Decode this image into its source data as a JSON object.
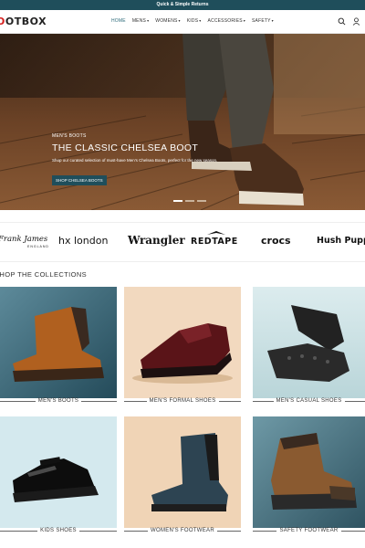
{
  "announcement": "Quick & Simple Returns",
  "logo": {
    "part_red": "FO",
    "part_black": "OTBOX"
  },
  "nav": [
    {
      "label": "HOME",
      "caret": false
    },
    {
      "label": "MENS",
      "caret": true
    },
    {
      "label": "WOMENS",
      "caret": true
    },
    {
      "label": "KIDS",
      "caret": true
    },
    {
      "label": "ACCESSORIES",
      "caret": true
    },
    {
      "label": "SAFETY",
      "caret": true
    }
  ],
  "icons": [
    "search-icon",
    "account-icon"
  ],
  "hero": {
    "eyebrow": "MEN'S BOOTS",
    "title": "THE CLASSIC CHELSEA BOOT",
    "description": "Shop our curated selection of must-have Men's Chelsea Boots, perfect for the new season.",
    "button": "SHOP CHELSEA BOOTS",
    "slide_count": 3,
    "active_slide": 1
  },
  "brands": [
    "Frank James",
    "ENGLAND",
    "hx london",
    "Wrangler",
    "REDTAPE",
    "crocs",
    "Hush Puppies"
  ],
  "collections_title": "SHOP THE COLLECTIONS",
  "collections": [
    {
      "label": "MEN'S BOOTS"
    },
    {
      "label": "MEN'S FORMAL SHOES"
    },
    {
      "label": "MEN'S CASUAL SHOES"
    },
    {
      "label": "KIDS SHOES"
    },
    {
      "label": "WOMEN'S FOOTWEAR"
    },
    {
      "label": "SAFETY FOOTWEAR"
    }
  ],
  "colors": {
    "accent": "#1f4e5b",
    "brand_red": "#d6201f",
    "active_nav": "#2c6a7a"
  }
}
